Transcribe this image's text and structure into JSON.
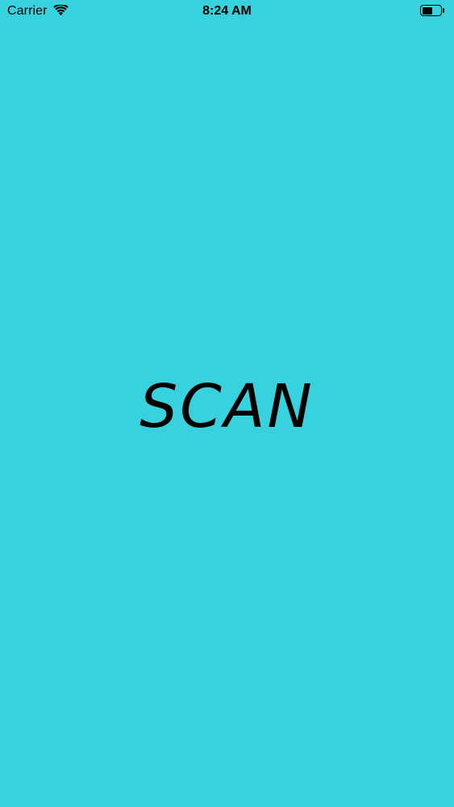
{
  "status_bar": {
    "carrier": "Carrier",
    "time": "8:24 AM",
    "battery_level": 0.55,
    "icons": {
      "wifi": "wifi-icon",
      "battery": "battery-icon"
    }
  },
  "main": {
    "title": "SCAN"
  },
  "colors": {
    "background": "#38D1DE",
    "text": "#000000"
  }
}
